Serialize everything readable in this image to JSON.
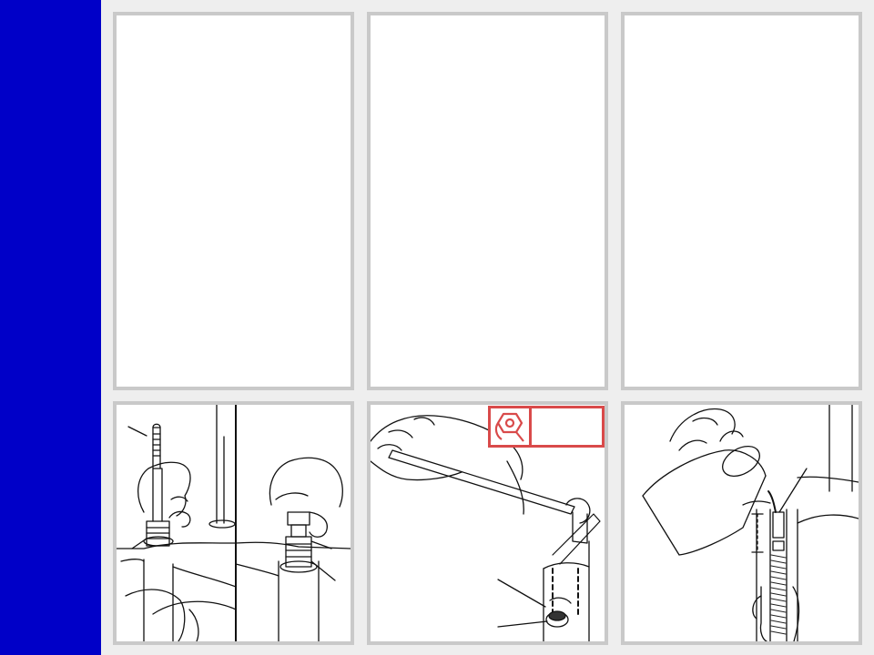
{
  "colors": {
    "sidebar": "#0000c8",
    "page_background": "#eeeeee",
    "panel_border": "#c9c9c9",
    "line_art": "#111111",
    "torque_badge": "#d94a4a"
  },
  "panels_top": [
    {
      "text": ""
    },
    {
      "text": ""
    },
    {
      "text": ""
    }
  ],
  "illustrations": [
    {
      "icon": "fork-crown-cartridge-removal"
    },
    {
      "icon": "socket-wrench-on-fork-leg"
    },
    {
      "icon": "pouring-oil-into-fork-leg"
    }
  ],
  "torque_badge": {
    "icon": "torque-wrench-icon",
    "value": ""
  }
}
